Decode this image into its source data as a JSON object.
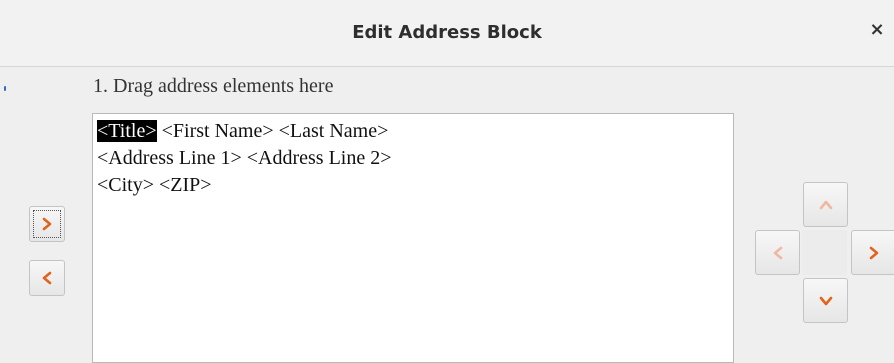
{
  "dialog": {
    "title": "Edit Address Block",
    "close_icon": "×"
  },
  "instructions": {
    "step1": "1. Drag address elements here"
  },
  "address_block": {
    "lines": [
      [
        {
          "text": "<Title>",
          "selected": true
        },
        {
          "text": " <First Name> <Last Name>",
          "selected": false
        }
      ],
      [
        {
          "text": "<Address Line 1> <Address Line 2>",
          "selected": false
        }
      ],
      [
        {
          "text": "<City> <ZIP>",
          "selected": false
        }
      ]
    ]
  },
  "buttons": {
    "add_to_block": {
      "icon": "chevron-right-icon",
      "state": "focused"
    },
    "remove_from_block": {
      "icon": "chevron-left-icon",
      "state": "normal"
    },
    "move_up": {
      "icon": "chevron-up-icon",
      "state": "disabled"
    },
    "move_left": {
      "icon": "chevron-left-icon",
      "state": "disabled"
    },
    "move_right": {
      "icon": "chevron-right-icon",
      "state": "normal"
    },
    "move_down": {
      "icon": "chevron-down-icon",
      "state": "normal"
    }
  },
  "colors": {
    "accent": "#e0641e",
    "selection_bg": "#000000",
    "selection_fg": "#ffffff"
  }
}
